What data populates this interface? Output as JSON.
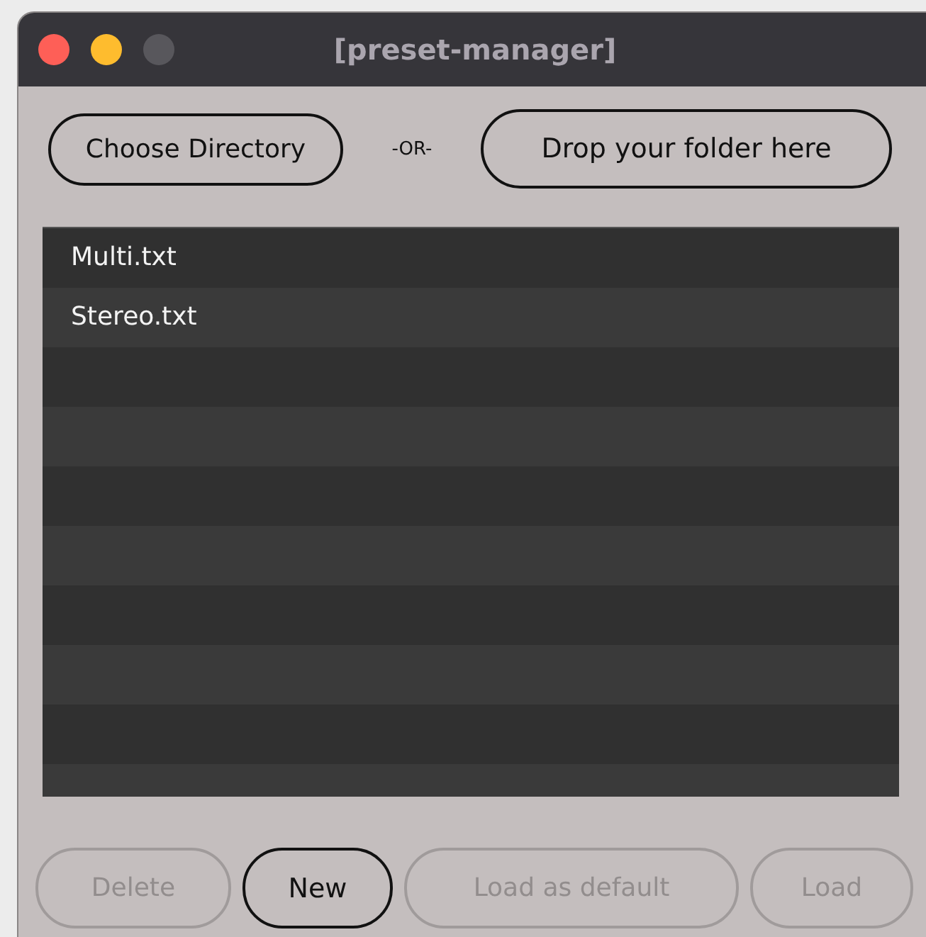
{
  "window": {
    "title": "[preset-manager]"
  },
  "source": {
    "choose_button": "Choose Directory",
    "separator": "-OR-",
    "drop_zone": "Drop your folder here"
  },
  "presets": [
    {
      "name": "Multi.txt",
      "selected": false
    },
    {
      "name": "Stereo.txt",
      "selected": false
    }
  ],
  "buttons": [
    {
      "label": "Delete",
      "disabled": true
    },
    {
      "label": "New",
      "disabled": false
    },
    {
      "label": "Load as default",
      "disabled": true
    },
    {
      "label": "Load",
      "disabled": true
    }
  ]
}
